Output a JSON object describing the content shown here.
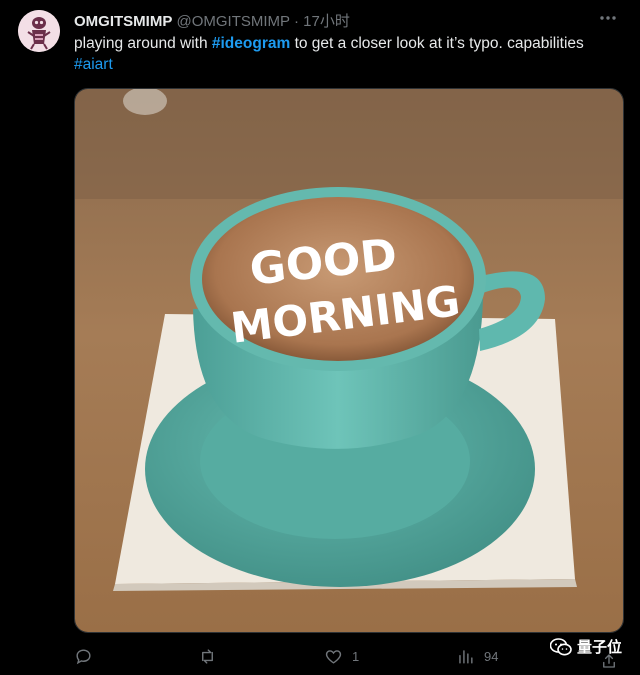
{
  "tweet": {
    "display_name": "OMGITSMIMP",
    "handle": "@OMGITSMIMP",
    "separator": "·",
    "time": "17小时",
    "text": {
      "part1": "playing around with ",
      "hashtag1": "#ideogram",
      "part2": " to get a closer look at it’s typo. capabilities",
      "hashtag2": "#aiart"
    },
    "image": {
      "latte_text_line1": "GOOD",
      "latte_text_line2": "MORNING"
    },
    "actions": {
      "reply_icon": "reply-icon",
      "retweet_icon": "retweet-icon",
      "like_icon": "heart-icon",
      "likes": "1",
      "views_icon": "bar-chart-icon",
      "views": "94",
      "share_icon": "share-icon"
    }
  },
  "watermark": {
    "icon": "wechat-icon",
    "label": "量子位"
  },
  "colors": {
    "background": "#000000",
    "text": "#e7e9ea",
    "muted": "#71767b",
    "link": "#1d9bf0",
    "cup": "#5fb8ae"
  }
}
